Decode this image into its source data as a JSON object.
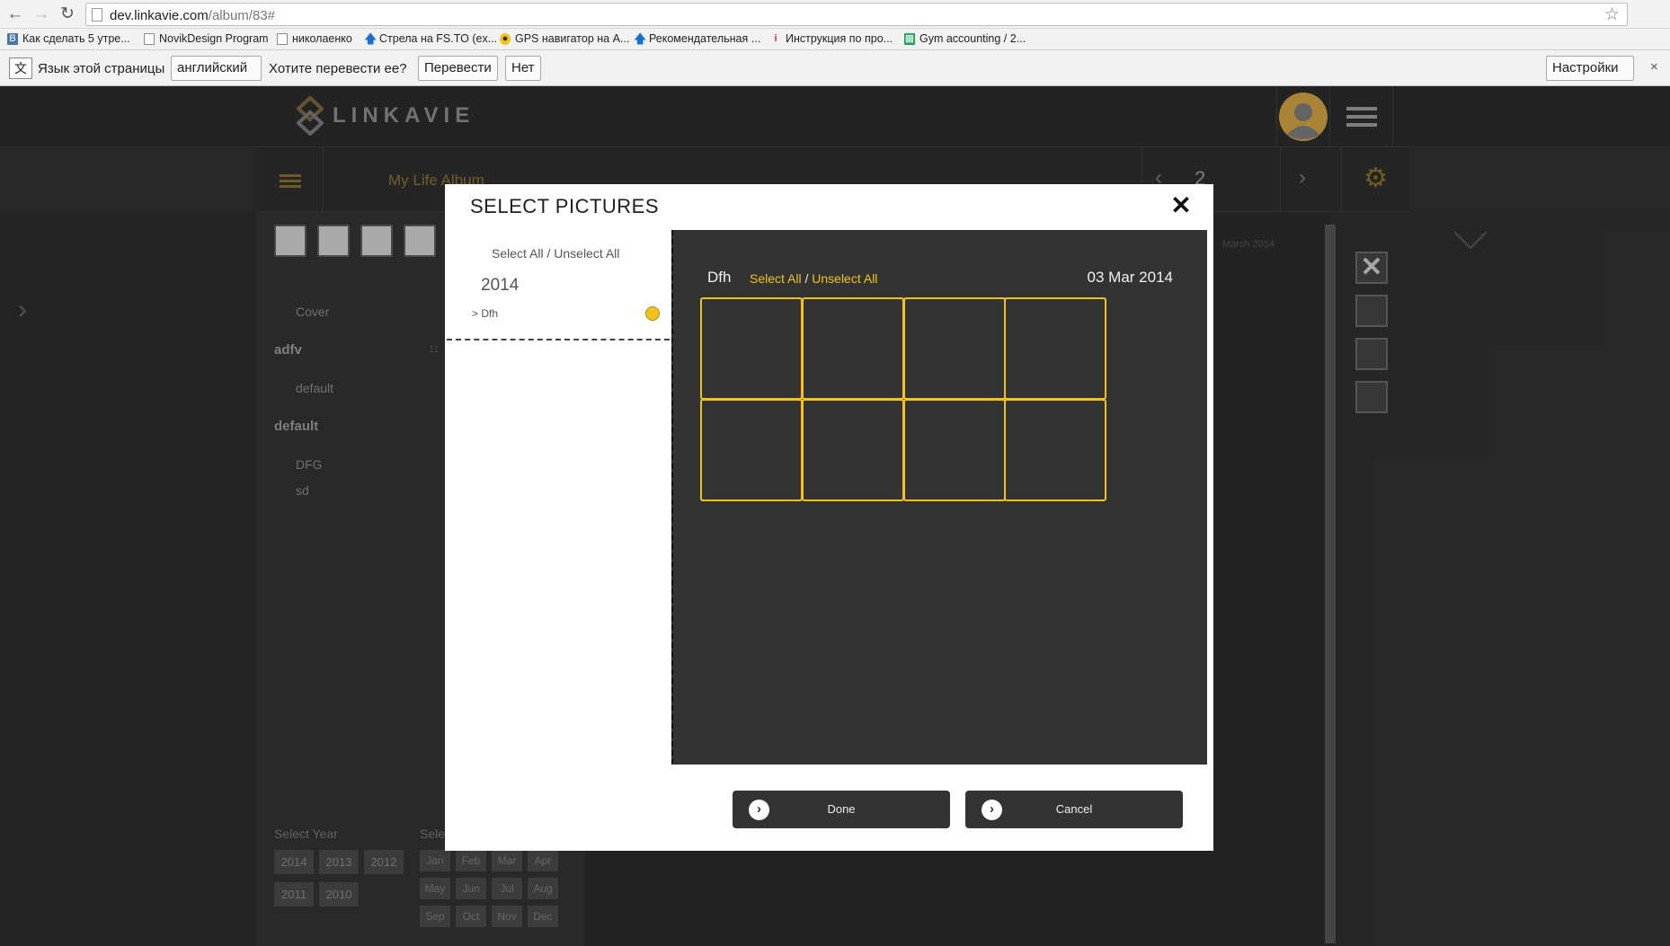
{
  "browser": {
    "url_host": "dev.linkavie.com",
    "url_path": "/album/83#",
    "bookmarks": [
      "Как сделать 5 утре...",
      "NovikDesign Program",
      "николаенко",
      "Стрела на FS.TO (ex...",
      "GPS навигатор на А...",
      "Рекомендательная ...",
      "Инструкция по про...",
      "Gym accounting / 2..."
    ]
  },
  "translate_bar": {
    "lang_label": "Язык этой страницы",
    "lang_value": "английский",
    "question": "Хотите перевести ее?",
    "translate_button": "Перевести",
    "no_button": "Нет",
    "settings_button": "Настройки"
  },
  "app": {
    "logo": "LINKAVIE",
    "album_title": "My Life Album",
    "page_number": "2",
    "panel": {
      "cover": "Cover",
      "section1": "adfv",
      "section1_count": "11",
      "default_item": "default",
      "section2": "default",
      "item_dfg": "DFG",
      "item_sd": "sd",
      "select_year_label": "Select Year",
      "select_month_label": "Sele",
      "years": [
        "2014",
        "2013",
        "2012",
        "2011",
        "2010"
      ],
      "months": [
        "Jan",
        "Feb",
        "Mar",
        "Apr",
        "May",
        "Jun",
        "Jul",
        "Aug",
        "Sep",
        "Oct",
        "Nov",
        "Dec"
      ]
    },
    "faded_right_text": "March 2014"
  },
  "modal": {
    "title": "SELECT PICTURES",
    "left": {
      "select_all": "Select All / Unselect All",
      "year": "2014",
      "album": "> Dfh"
    },
    "right": {
      "album_name": "Dfh",
      "select_all": "Select All",
      "separator": " / ",
      "unselect_all": "Unselect All",
      "date": "03 Mar 2014"
    },
    "thumbnail_count": 8,
    "done_label": "Done",
    "cancel_label": "Cancel"
  },
  "colors": {
    "accent": "#f3c31c",
    "dark": "#333333"
  }
}
